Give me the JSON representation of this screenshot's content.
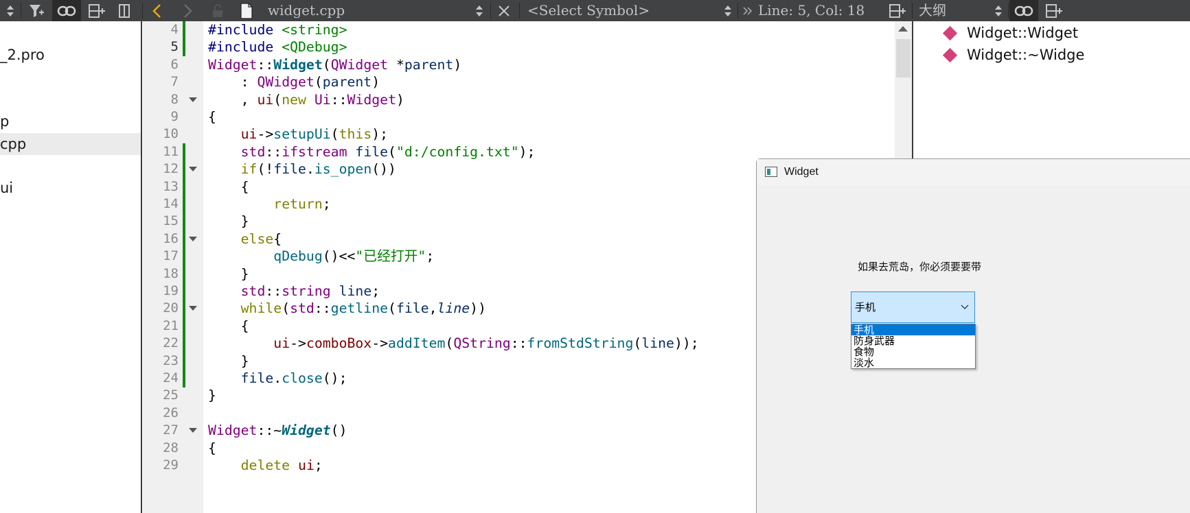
{
  "toolbar": {
    "file_name": "widget.cpp",
    "symbol_placeholder": "<Select Symbol>",
    "position": "Line: 5, Col: 18",
    "outline_title": "大纲"
  },
  "project_tree": {
    "items": [
      {
        "label": "_2.pro",
        "selected": false
      },
      {
        "label": "p",
        "selected": false
      },
      {
        "label": "cpp",
        "selected": true
      },
      {
        "label": "ui",
        "selected": false
      }
    ]
  },
  "editor": {
    "current_line": 5,
    "lines": [
      {
        "n": "4",
        "code": "#include <string>"
      },
      {
        "n": "5",
        "code": "#include <QDebug>"
      },
      {
        "n": "6",
        "code": "Widget::Widget(QWidget *parent)"
      },
      {
        "n": "7",
        "code": "    : QWidget(parent)"
      },
      {
        "n": "8",
        "code": "    , ui(new Ui::Widget)"
      },
      {
        "n": "9",
        "code": "{"
      },
      {
        "n": "10",
        "code": "    ui->setupUi(this);"
      },
      {
        "n": "11",
        "code": "    std::ifstream file(\"d:/config.txt\");"
      },
      {
        "n": "12",
        "code": "    if(!file.is_open())"
      },
      {
        "n": "13",
        "code": "    {"
      },
      {
        "n": "14",
        "code": "        return;"
      },
      {
        "n": "15",
        "code": "    }"
      },
      {
        "n": "16",
        "code": "    else{"
      },
      {
        "n": "17",
        "code": "        qDebug()<<\"已经打开\";"
      },
      {
        "n": "18",
        "code": "    }"
      },
      {
        "n": "19",
        "code": "    std::string line;"
      },
      {
        "n": "20",
        "code": "    while(std::getline(file,line))"
      },
      {
        "n": "21",
        "code": "    {"
      },
      {
        "n": "22",
        "code": "        ui->comboBox->addItem(QString::fromStdString(line));"
      },
      {
        "n": "23",
        "code": "    }"
      },
      {
        "n": "24",
        "code": "    file.close();"
      },
      {
        "n": "25",
        "code": "}"
      },
      {
        "n": "26",
        "code": ""
      },
      {
        "n": "27",
        "code": "Widget::~Widget()"
      },
      {
        "n": "28",
        "code": "{"
      },
      {
        "n": "29",
        "code": "    delete ui;"
      }
    ],
    "fold_lines": [
      "8",
      "12",
      "16",
      "20",
      "27"
    ]
  },
  "outline": {
    "items": [
      "Widget::Widget",
      "Widget::~Widge"
    ]
  },
  "app_window": {
    "title": "Widget",
    "label": "如果去荒岛，你必须要要带",
    "combo_value": "手机",
    "options": [
      "手机",
      "防身武器",
      "食物",
      "淡水"
    ]
  },
  "colors": {
    "toolbar_bg": "#404244",
    "change_marker": "#128a12",
    "outline_diamond": "#d4407a",
    "selection_blue": "#0078d7"
  }
}
